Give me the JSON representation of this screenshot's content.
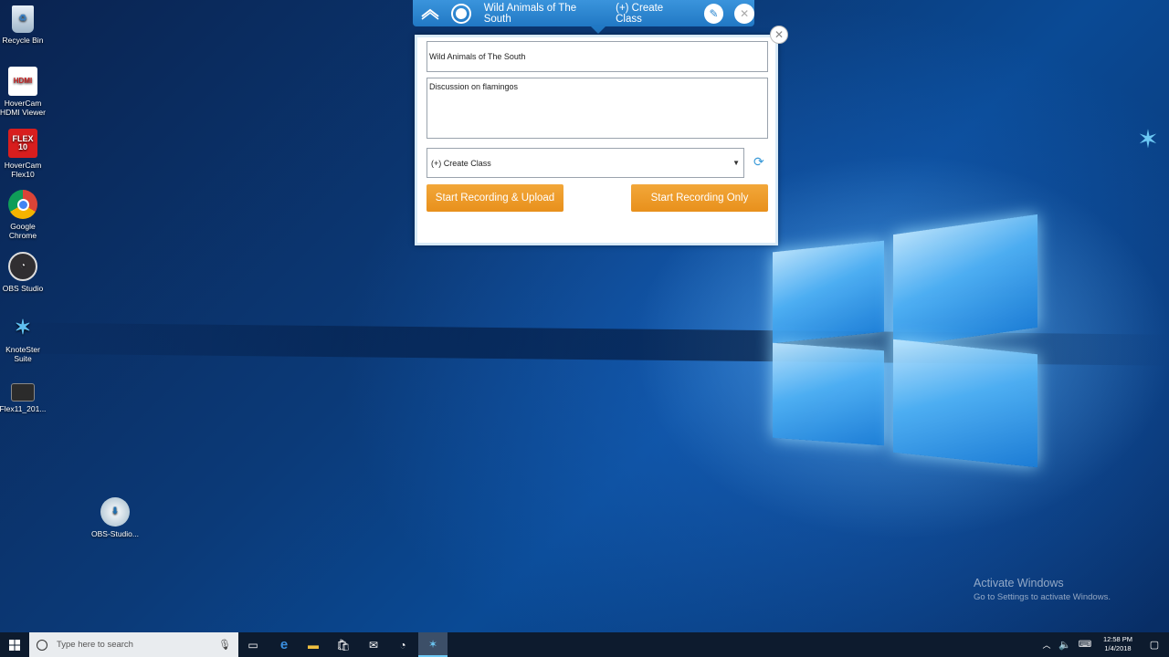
{
  "desktop": {
    "icons": [
      {
        "label": "Recycle Bin",
        "icon": "recycle-bin-icon"
      },
      {
        "label": "HoverCam HDMI Viewer",
        "icon": "hdmi-icon",
        "glyph": "HDMI"
      },
      {
        "label": "HoverCam Flex10",
        "icon": "flex10-icon",
        "glyph": "FLEX 10"
      },
      {
        "label": "Google Chrome",
        "icon": "chrome-icon"
      },
      {
        "label": "OBS Studio",
        "icon": "obs-icon"
      },
      {
        "label": "KnoteSter Suite",
        "icon": "knotester-icon"
      },
      {
        "label": "Flex11_201...",
        "icon": "video-file-icon"
      },
      {
        "label": "OBS-Studio...",
        "icon": "installer-icon"
      }
    ]
  },
  "toolbar": {
    "title": "Wild Animals of The South",
    "class_label": "(+) Create Class"
  },
  "panel": {
    "title_value": "Wild Animals of The South",
    "description_value": "Discussion on flamingos",
    "class_select": "(+) Create Class",
    "record_upload_label": "Start Recording & Upload",
    "record_only_label": "Start Recording Only"
  },
  "watermark": {
    "heading": "Activate Windows",
    "subtext": "Go to Settings to activate Windows."
  },
  "taskbar": {
    "search_placeholder": "Type here to search",
    "time": "12:58 PM",
    "date": "1/4/2018"
  },
  "colors": {
    "toolbar_blue": "#2a86d0",
    "button_orange": "#ec9a27",
    "taskbar": "#0d1b2e"
  }
}
